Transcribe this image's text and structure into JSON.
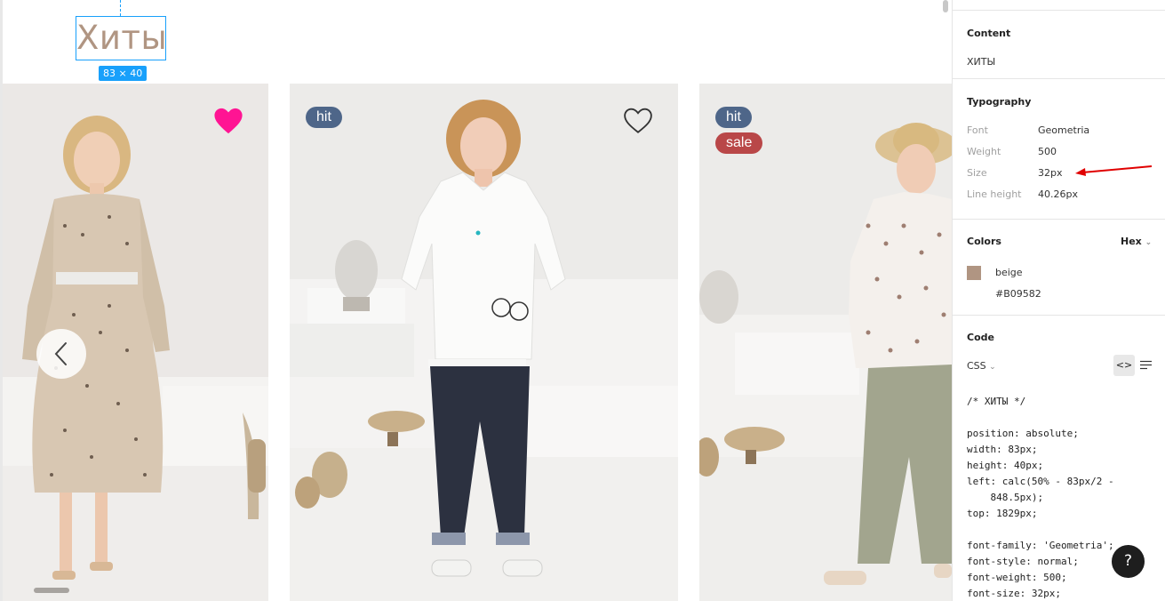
{
  "canvas": {
    "heading_text": "Хиты",
    "dimension_badge": "83 × 40",
    "products": [
      {
        "badges": [],
        "favorited": true
      },
      {
        "badges": [
          "hit"
        ],
        "favorited": false
      },
      {
        "badges": [
          "hit",
          "sale"
        ],
        "favorited": false
      }
    ],
    "badge_hit": "hit",
    "badge_sale": "sale"
  },
  "inspector": {
    "content": {
      "title": "Content",
      "value": "ХИТЫ"
    },
    "typography": {
      "title": "Typography",
      "font_label": "Font",
      "font_value": "Geometria",
      "weight_label": "Weight",
      "weight_value": "500",
      "size_label": "Size",
      "size_value": "32px",
      "line_height_label": "Line height",
      "line_height_value": "40.26px"
    },
    "colors": {
      "title": "Colors",
      "format": "Hex",
      "swatch_name": "beige",
      "swatch_hex": "#B09582"
    },
    "code": {
      "title": "Code",
      "language": "CSS",
      "lines": [
        "/* ХИТЫ */",
        "",
        "position: absolute;",
        "width: 83px;",
        "height: 40px;",
        "left: calc(50% - 83px/2 -",
        "    848.5px);",
        "top: 1829px;",
        "",
        "font-family: 'Geometria';",
        "font-style: normal;",
        "font-weight: 500;",
        "font-size: 32px;"
      ]
    },
    "help_label": "?"
  },
  "colors": {
    "selection": "#18a0fb",
    "heading": "#b09582",
    "heart_active": "#ff1493",
    "badge_hit": "#4e6689",
    "badge_sale": "#b94748",
    "annotation_arrow": "#e00000"
  }
}
